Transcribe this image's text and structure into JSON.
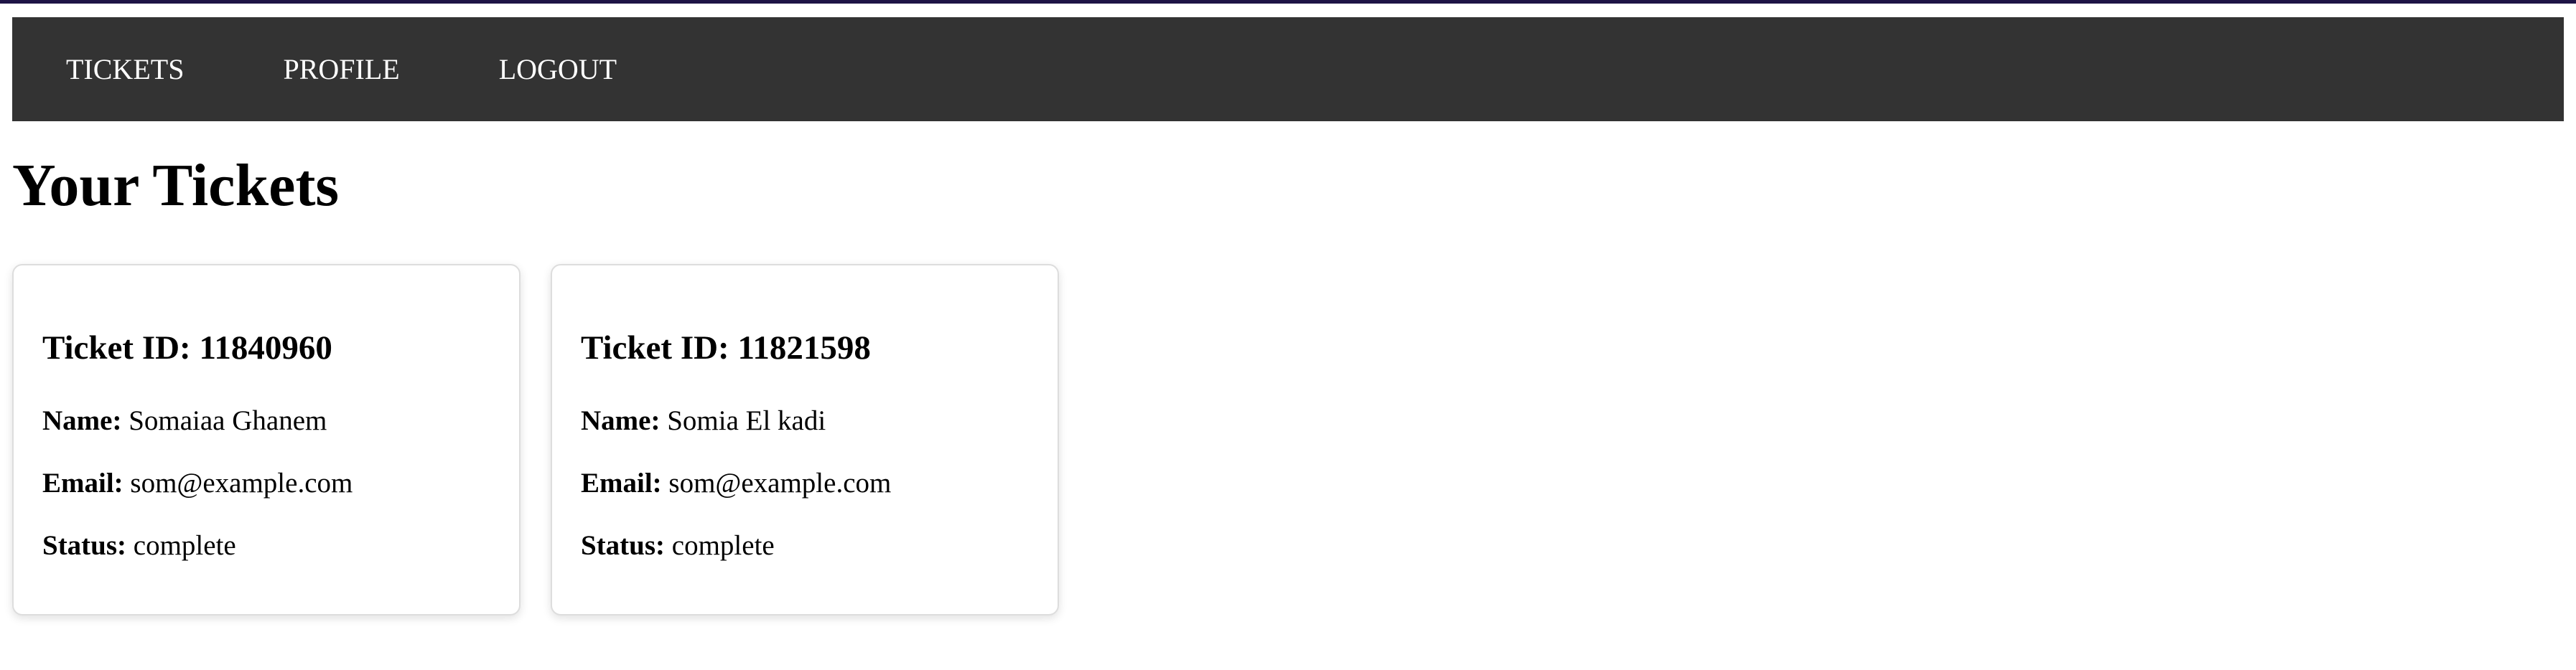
{
  "nav": {
    "items": [
      {
        "label": "TICKETS"
      },
      {
        "label": "PROFILE"
      },
      {
        "label": "LOGOUT"
      }
    ]
  },
  "page": {
    "title": "Your Tickets"
  },
  "tickets": [
    {
      "title": "Ticket ID: 11840960",
      "name_label": "Name:",
      "name": "Somaiaa Ghanem",
      "email_label": "Email:",
      "email": "som@example.com",
      "status_label": "Status:",
      "status": "complete"
    },
    {
      "title": "Ticket ID: 11821598",
      "name_label": "Name:",
      "name": "Somia El kadi",
      "email_label": "Email:",
      "email": "som@example.com",
      "status_label": "Status:",
      "status": "complete"
    }
  ],
  "colors": {
    "navbar_bg": "#333333",
    "nav_text": "#ffffff",
    "top_accent": "#1e1446",
    "card_border": "#dddddd"
  }
}
